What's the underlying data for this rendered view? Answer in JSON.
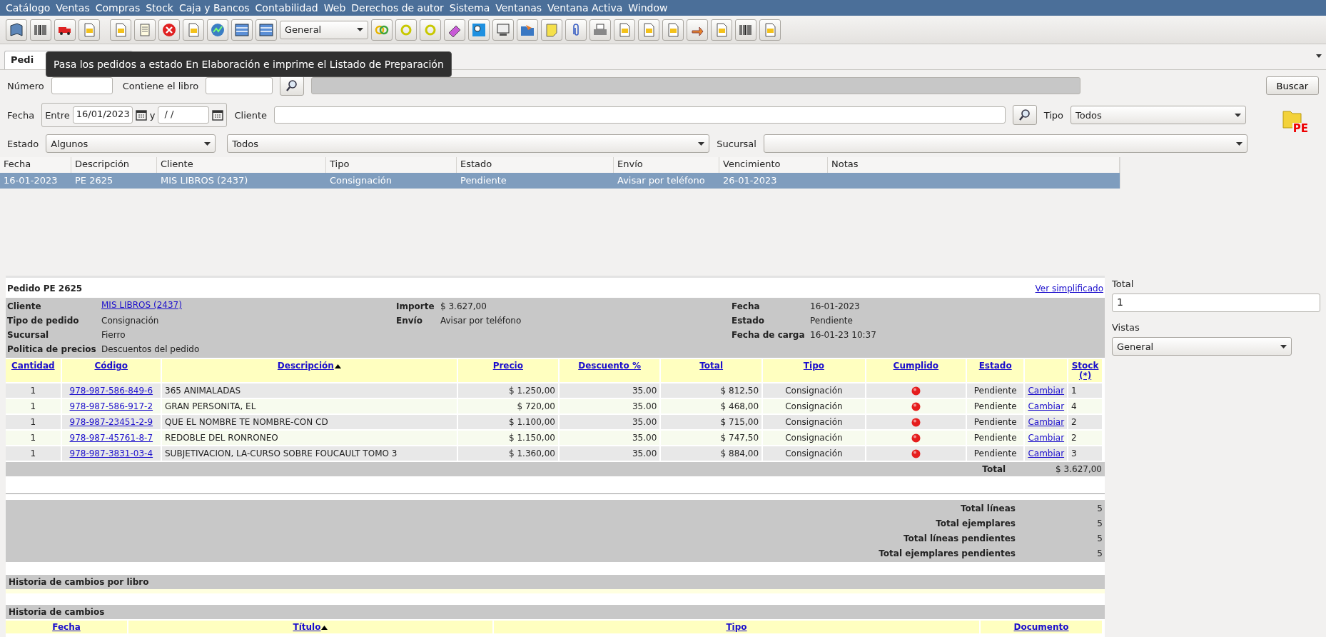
{
  "menu": [
    "Catálogo",
    "Ventas",
    "Compras",
    "Stock",
    "Caja y Bancos",
    "Contabilidad",
    "Web",
    "Derechos de autor",
    "Sistema",
    "Ventanas",
    "Ventana Activa",
    "Window"
  ],
  "toolbar": {
    "view_select": "General"
  },
  "tabs": [
    {
      "label": "Pedi",
      "selected": true
    }
  ],
  "tooltip": "Pasa los pedidos a estado En Elaboración e imprime el Listado de Preparación",
  "filters": {
    "numero_label": "Número",
    "libro_label": "Contiene el libro",
    "buscar": "Buscar",
    "fecha_label": "Fecha",
    "entre_label": "Entre",
    "fecha_desde": "16/01/2023",
    "y_label": "y",
    "fecha_hasta": " / /",
    "cliente_label": "Cliente",
    "tipo_label": "Tipo",
    "tipo_value": "Todos",
    "estado_label": "Estado",
    "estado_value": "Algunos",
    "estado_value_2": "Todos",
    "sucursal_label": "Sucursal",
    "badge": "PE"
  },
  "results": {
    "columns": [
      "Fecha",
      "Descripción",
      "Cliente",
      "Tipo",
      "Estado",
      "Envío",
      "Vencimiento",
      "Notas"
    ],
    "rows": [
      {
        "cells": [
          "16-01-2023",
          "PE 2625",
          "MIS LIBROS (2437)",
          "Consignación",
          "Pendiente",
          "Avisar por teléfono",
          "26-01-2023",
          ""
        ],
        "selected": true
      }
    ]
  },
  "detail": {
    "title": "Pedido PE 2625",
    "simplified_link": "Ver simplificado",
    "info": [
      {
        "label": "Cliente",
        "value": "MIS LIBROS (2437)",
        "link": true
      },
      {
        "label": "Tipo de pedido",
        "value": "Consignación",
        "link": false
      },
      {
        "label": "Sucursal",
        "value": "Fierro",
        "link": false
      },
      {
        "label": "Politica de precios",
        "value": "Descuentos del pedido",
        "link": false
      }
    ],
    "info_2": [
      {
        "label": "Importe",
        "value": "$ 3.627,00"
      },
      {
        "label": "Envío",
        "value": "Avisar por teléfono"
      }
    ],
    "info_3": [
      {
        "label": "Fecha",
        "value": "16-01-2023"
      },
      {
        "label": "Estado",
        "value": "Pendiente"
      },
      {
        "label": "Fecha de carga",
        "value": "16-01-23 10:37"
      }
    ],
    "columns": [
      {
        "label": "Cantidad",
        "sorted": false
      },
      {
        "label": "Código",
        "sorted": false
      },
      {
        "label": "Descripción",
        "sorted": true
      },
      {
        "label": "Precio",
        "sorted": false
      },
      {
        "label": "Descuento %",
        "sorted": false
      },
      {
        "label": "Total",
        "sorted": false
      },
      {
        "label": "Tipo",
        "sorted": false
      },
      {
        "label": "Cumplido",
        "sorted": false
      },
      {
        "label": "Estado",
        "sorted": false
      },
      {
        "sorted": false
      },
      {
        "label": "Stock (*)",
        "sorted": false
      }
    ],
    "items": [
      {
        "cantidad": "1",
        "codigo": "978-987-586-849-6",
        "descripcion": "365 ANIMALADAS",
        "precio": "$ 1.250,00",
        "descuento": "35.00",
        "total": "$ 812,50",
        "tipo": "Consignación",
        "cumplido": false,
        "estado": "Pendiente",
        "accion": "Cambiar",
        "stock": "1"
      },
      {
        "cantidad": "1",
        "codigo": "978-987-586-917-2",
        "descripcion": "GRAN PERSONITA, EL",
        "precio": "$ 720,00",
        "descuento": "35.00",
        "total": "$ 468,00",
        "tipo": "Consignación",
        "cumplido": false,
        "estado": "Pendiente",
        "accion": "Cambiar",
        "stock": "4"
      },
      {
        "cantidad": "1",
        "codigo": "978-987-23451-2-9",
        "descripcion": "QUE EL NOMBRE TE NOMBRE-CON CD",
        "precio": "$ 1.100,00",
        "descuento": "35.00",
        "total": "$ 715,00",
        "tipo": "Consignación",
        "cumplido": false,
        "estado": "Pendiente",
        "accion": "Cambiar",
        "stock": "2"
      },
      {
        "cantidad": "1",
        "codigo": "978-987-45761-8-7",
        "descripcion": "REDOBLE DEL RONRONEO",
        "precio": "$ 1.150,00",
        "descuento": "35.00",
        "total": "$ 747,50",
        "tipo": "Consignación",
        "cumplido": false,
        "estado": "Pendiente",
        "accion": "Cambiar",
        "stock": "2"
      },
      {
        "cantidad": "1",
        "codigo": "978-987-3831-03-4",
        "descripcion": "SUBJETIVACION, LA-CURSO SOBRE FOUCAULT TOMO 3",
        "precio": "$ 1.360,00",
        "descuento": "35.00",
        "total": "$ 884,00",
        "tipo": "Consignación",
        "cumplido": false,
        "estado": "Pendiente",
        "accion": "Cambiar",
        "stock": "3"
      }
    ],
    "total_label": "Total",
    "total_value": "$ 3.627,00",
    "summary": [
      {
        "label": "Total líneas",
        "value": "5"
      },
      {
        "label": "Total ejemplares",
        "value": "5"
      },
      {
        "label": "Total líneas pendientes",
        "value": "5"
      },
      {
        "label": "Total ejemplares pendientes",
        "value": "5"
      }
    ],
    "history_by_book": "Historia de cambios por libro",
    "history": "Historia de cambios",
    "history_columns": [
      {
        "label": "Fecha",
        "sorted": false
      },
      {
        "label": "Título",
        "sorted": true
      },
      {
        "label": "Tipo",
        "sorted": false
      },
      {
        "label": "Documento",
        "sorted": false
      }
    ]
  },
  "side": {
    "total_label": "Total",
    "total_value": "1",
    "vistas_label": "Vistas",
    "vistas_value": "General"
  }
}
